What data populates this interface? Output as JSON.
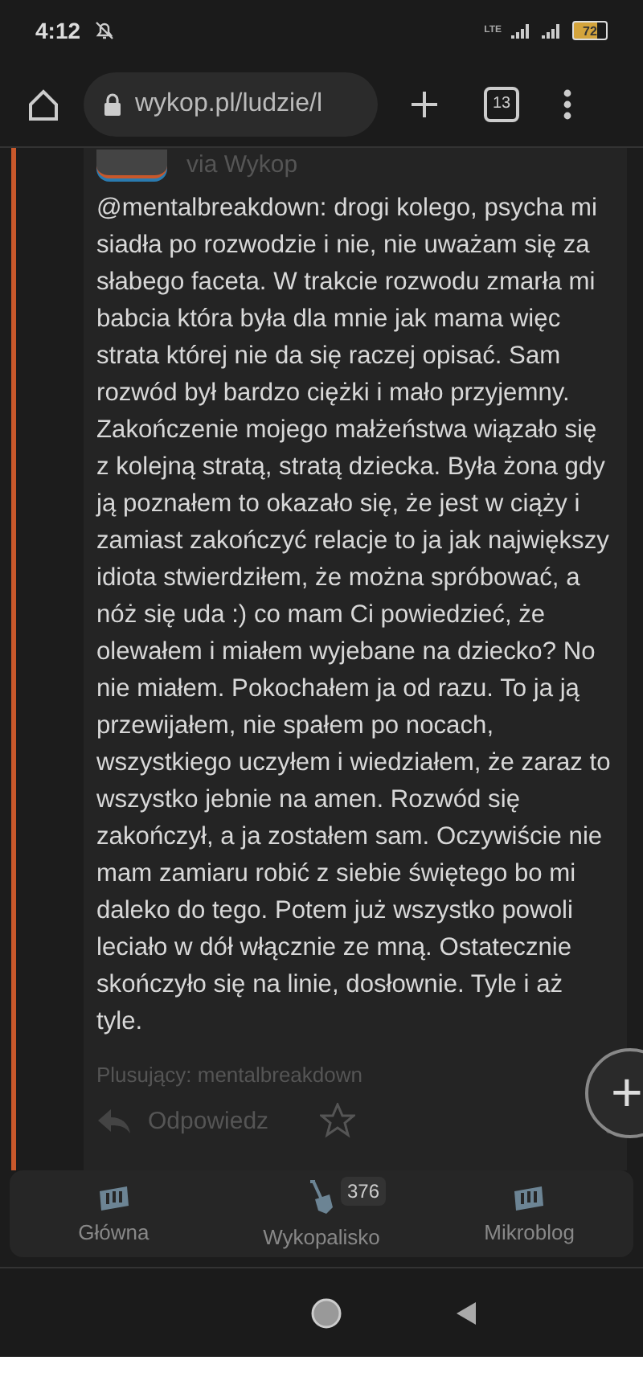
{
  "status_bar": {
    "time": "4:12",
    "network": "LTE",
    "battery": "72"
  },
  "browser": {
    "url": "wykop.pl/ludzie/l",
    "tab_count": "13"
  },
  "entry": {
    "source": "via Wykop",
    "text": "@mentalbreakdown: drogi kolego, psycha mi siadła po rozwodzie i nie, nie uważam się za słabego faceta. W trakcie rozwodu zmarła mi babcia która była dla mnie jak mama więc strata której nie da się raczej opisać. Sam rozwód był bardzo ciężki i mało przyjemny. Zakończenie mojego małżeństwa wiązało się z kolejną stratą, stratą dziecka. Była żona gdy ją poznałem to okazało się, że jest w ciąży i zamiast zakończyć relacje to ja jak największy idiota stwierdziłem, że można spróbować, a nóż się uda :) co mam Ci powiedzieć, że olewałem i miałem wyjebane na dziecko? No nie miałem. Pokochałem ja od razu. To ja ją przewijałem, nie spałem po nocach, wszystkiego uczyłem i wiedziałem, że zaraz to wszystko jebnie na amen. Rozwód się zakończył, a ja zostałem sam. Oczywiście nie mam zamiaru robić z siebie świętego bo mi daleko do tego. Potem już wszystko powoli leciało w dół włącznie ze mną. Ostatecznie skończyło się na linie, dosłownie. Tyle i aż tyle.",
    "voters": "Plusujący: mentalbreakdown",
    "reply": "Odpowiedz",
    "favorite": false
  },
  "fab": {
    "label": "+"
  },
  "bottom_nav": [
    {
      "label": "Główna",
      "kind": "home",
      "selected": false
    },
    {
      "label": "Wykopalisko",
      "kind": "dig",
      "selected": false,
      "badge": "376"
    },
    {
      "label": "Mikroblog",
      "kind": "micro",
      "selected": false
    }
  ]
}
